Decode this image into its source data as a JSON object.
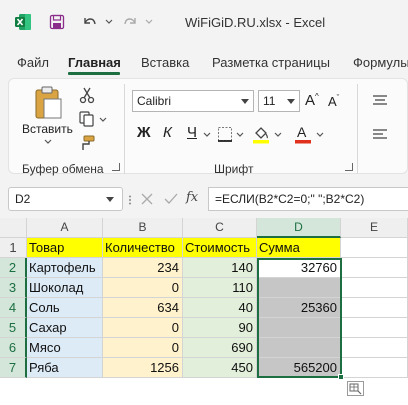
{
  "window": {
    "title": "WiFiGiD.RU.xlsx  -  Excel",
    "app_icon": "excel-icon"
  },
  "quick_access": [
    {
      "name": "save-icon"
    },
    {
      "name": "undo-icon"
    },
    {
      "name": "redo-icon"
    }
  ],
  "ribbon": {
    "tabs": [
      "Файл",
      "Главная",
      "Вставка",
      "Разметка страницы",
      "Формулы"
    ],
    "active_tab": "Главная",
    "clipboard": {
      "paste_label": "Вставить",
      "group_label": "Буфер обмена"
    },
    "font": {
      "name": "Calibri",
      "size": "11",
      "bold": "Ж",
      "italic": "К",
      "underline": "Ч",
      "group_label": "Шрифт"
    }
  },
  "formula_bar": {
    "name_box": "D2",
    "fx": "fx",
    "formula": "=ЕСЛИ(B2*C2=0;\" \";B2*C2)"
  },
  "sheet": {
    "columns": [
      "A",
      "B",
      "C",
      "D",
      "E"
    ],
    "selected_column": "D",
    "rows": [
      "1",
      "2",
      "3",
      "4",
      "5",
      "6",
      "7"
    ],
    "header": [
      "Товар",
      "Количество",
      "Стоимость",
      "Сумма"
    ],
    "data": [
      {
        "item": "Картофель",
        "qty": "234",
        "price": "140",
        "sum": "32760"
      },
      {
        "item": "Шоколад",
        "qty": "0",
        "price": "110",
        "sum": ""
      },
      {
        "item": "Соль",
        "qty": "634",
        "price": "40",
        "sum": "25360"
      },
      {
        "item": "Сахар",
        "qty": "0",
        "price": "90",
        "sum": ""
      },
      {
        "item": "Мясо",
        "qty": "0",
        "price": "690",
        "sum": ""
      },
      {
        "item": "Ряба",
        "qty": "1256",
        "price": "450",
        "sum": "565200"
      }
    ],
    "colors": {
      "header_fill": "#ffff00",
      "item_fill": "#ddebf7",
      "qty_fill": "#fff2cc",
      "price_fill": "#e2efda",
      "sum_fill": "#ffffff",
      "selected_fill": "#c6c6c6",
      "accent": "#1d6f42"
    }
  }
}
